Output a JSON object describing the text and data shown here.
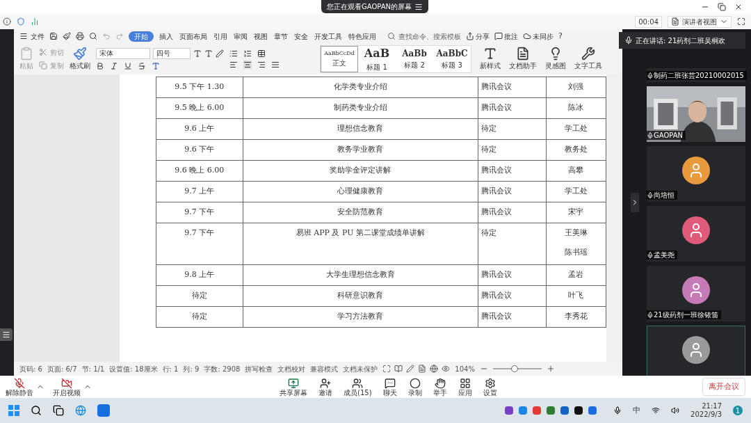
{
  "viewing_banner": "您正在观看GAOPAN的屏幕",
  "meeting_bar": {
    "timer": "00:04",
    "view_button": "演讲者视图"
  },
  "menu": {
    "file": "文件",
    "tabs": [
      {
        "label": "开始",
        "selected": true
      },
      {
        "label": "插入",
        "selected": false
      },
      {
        "label": "页面布局",
        "selected": false
      },
      {
        "label": "引用",
        "selected": false
      },
      {
        "label": "审阅",
        "selected": false
      },
      {
        "label": "视图",
        "selected": false
      },
      {
        "label": "章节",
        "selected": false
      },
      {
        "label": "安全",
        "selected": false
      },
      {
        "label": "开发工具",
        "selected": false
      },
      {
        "label": "特色应用",
        "selected": false
      }
    ],
    "search_placeholder": "查找命令、搜索模板",
    "actions": [
      "分享",
      "批注",
      "未同步"
    ],
    "help": "?"
  },
  "ribbon": {
    "clipboard": [
      "粘贴",
      "剪切",
      "复制"
    ],
    "format_painter": "格式刷",
    "font": "宋体",
    "size": "四号",
    "styles": [
      {
        "preview": "AaBbCcDd",
        "label": "正文",
        "selected": true
      },
      {
        "preview": "AaB",
        "label": "标题 1",
        "selected": false
      },
      {
        "preview": "AaBb",
        "label": "标题 2",
        "selected": false
      },
      {
        "preview": "AaBbC",
        "label": "标题 3",
        "selected": false
      }
    ],
    "tools": [
      "新样式",
      "文档助手",
      "灵感图",
      "文字工具"
    ]
  },
  "table": {
    "rows": [
      {
        "time": "9.5 下午 1.30",
        "topic": "化学类专业介绍",
        "platform": "腾讯会议",
        "people": [
          "刘强"
        ]
      },
      {
        "time": "9.5 晚上 6.00",
        "topic": "制药类专业介绍",
        "platform": "腾讯会议",
        "people": [
          "陈冰"
        ]
      },
      {
        "time": "9.6 上午",
        "topic": "理想信念教育",
        "platform": "待定",
        "people": [
          "学工处"
        ]
      },
      {
        "time": "9.6 下午",
        "topic": "教务学业教育",
        "platform": "待定",
        "people": [
          "教务处"
        ]
      },
      {
        "time": "9.6 晚上 6.00",
        "topic": "奖助学金评定讲解",
        "platform": "腾讯会议",
        "people": [
          "高攀"
        ]
      },
      {
        "time": "9.7 上午",
        "topic": "心理健康教育",
        "platform": "腾讯会议",
        "people": [
          "学工处"
        ]
      },
      {
        "time": "9.7 下午",
        "topic": "安全防范教育",
        "platform": "腾讯会议",
        "people": [
          "宋宇"
        ]
      },
      {
        "time": "9.7 下午",
        "topic": "易班 APP 及 PU 第二课堂成绩单讲解",
        "platform": "待定",
        "people": [
          "王美琳",
          "陈书瑶"
        ]
      },
      {
        "time": "9.8 上午",
        "topic": "大学生理想信念教育",
        "platform": "腾讯会议",
        "people": [
          "孟岩"
        ]
      },
      {
        "time": "待定",
        "topic": "科研意识教育",
        "platform": "腾讯会议",
        "people": [
          "叶飞"
        ]
      },
      {
        "time": "待定",
        "topic": "学习方法教育",
        "platform": "腾讯会议",
        "people": [
          "李秀花"
        ]
      }
    ]
  },
  "status_bar": {
    "items": [
      "页码: 6",
      "页面: 6/7",
      "节: 1/1",
      "设置值: 18厘米",
      "行: 1",
      "列: 9",
      "字数: 2908"
    ],
    "checks": [
      "拼写检查",
      "文档校对",
      "兼容模式",
      "文档未保护"
    ],
    "zoom": "104%",
    "zoom_slider": {
      "level": 0.45
    }
  },
  "speaking": "正在讲话: 21药剂二班吴桐欢",
  "participants": [
    {
      "kind": "cut",
      "name": "制药二班张芸20210002015"
    },
    {
      "kind": "video",
      "name": "GAOPAN"
    },
    {
      "kind": "avatar",
      "name": "尚培恒",
      "color": "#e89a3c"
    },
    {
      "kind": "avatar",
      "name": "孟美尧",
      "color": "#e05a7a"
    },
    {
      "kind": "avatar",
      "name": "21级药剂一班徐铱笛",
      "color": "#c77ab8"
    },
    {
      "kind": "avatar",
      "color": "#9a9a9a"
    }
  ],
  "toolbar": {
    "left": [
      "解除静音",
      "开启视频"
    ],
    "center": [
      "共享屏幕",
      "邀请",
      "成员(15)",
      "聊天",
      "录制",
      "举手",
      "应用",
      "设置"
    ],
    "leave": "离开会议"
  },
  "taskbar": {
    "ime": "中",
    "time": "21:17",
    "date": "2022/9/3",
    "notifications": "1"
  }
}
